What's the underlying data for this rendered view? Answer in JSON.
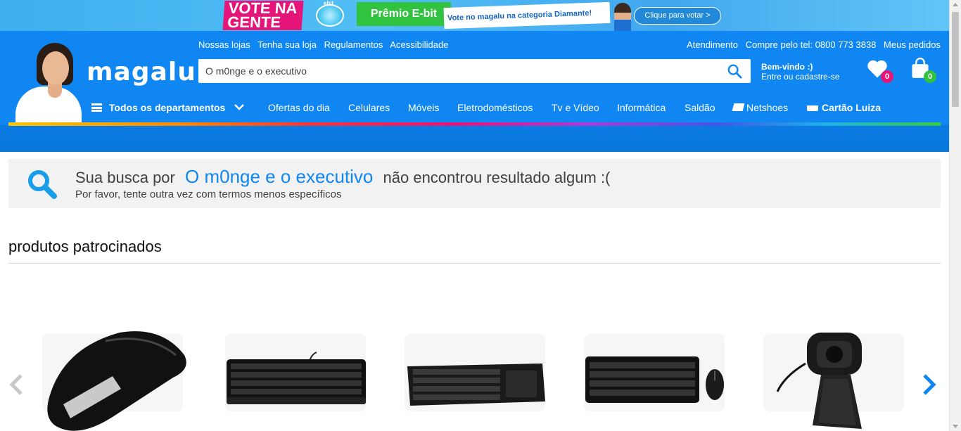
{
  "promo": {
    "vote_line1": "VOTE NA",
    "vote_line2": "GENTE",
    "ebit_tag": "ebit",
    "premio": "Prêmio E-bit",
    "category": "Vote no magalu na categoria Diamante!",
    "cta": "Clique para votar >"
  },
  "header": {
    "logo": "magalu",
    "links_left": [
      "Nossas lojas",
      "Tenha sua loja",
      "Regulamentos",
      "Acessibilidade"
    ],
    "links_right": [
      "Atendimento",
      "Compre pelo tel: 0800 773 3838",
      "Meus pedidos"
    ],
    "search": {
      "value": "O m0nge e o executivo",
      "icon": "search-icon"
    },
    "welcome": {
      "line1": "Bem-vindo :)",
      "line2": "Entre ou cadastre-se"
    },
    "wishlist_count": "0",
    "cart_count": "0",
    "departments": "Todos os departamentos",
    "nav": [
      "Ofertas do dia",
      "Celulares",
      "Móveis",
      "Eletrodomésticos",
      "Tv e Vídeo",
      "Informática",
      "Saldão",
      "Netshoes",
      "Cartão Luiza"
    ]
  },
  "notice": {
    "prefix": "Sua busca por",
    "term": "O m0nge e o executivo",
    "suffix": "não encontrou resultado algum :(",
    "hint": "Por favor, tente outra vez com termos menos específicos"
  },
  "sponsored": {
    "title": "produtos patrocinados",
    "products": [
      "mouse-arc",
      "keyboard-wired",
      "keyboard-touchpad",
      "keyboard-mouse-combo",
      "webcam"
    ]
  },
  "colors": {
    "brand_blue": "#0f86f1",
    "wishlist_badge": "#e6157a",
    "cart_badge": "#31c240"
  }
}
